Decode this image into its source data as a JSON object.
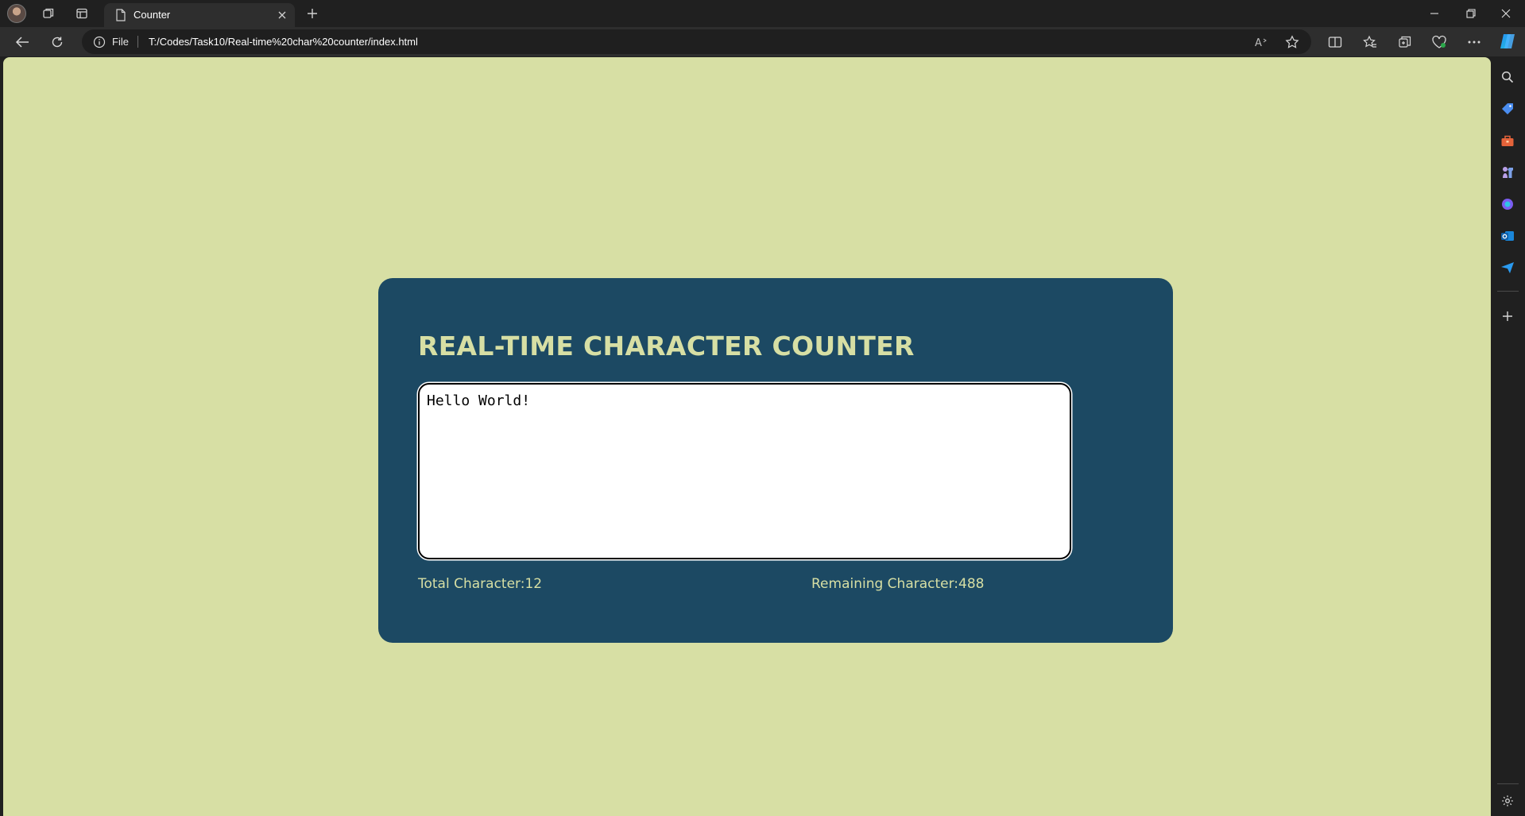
{
  "browser": {
    "tab_title": "Counter",
    "address_prefix": "File",
    "url": "T:/Codes/Task10/Real-time%20char%20counter/index.html"
  },
  "app": {
    "title": "REAL-TIME CHARACTER COUNTER",
    "textarea_value": "Hello World!",
    "total_label": "Total Character:",
    "total_count": "12",
    "remaining_label": "Remaining Character:",
    "remaining_count": "488"
  },
  "colors": {
    "page_background": "#d7dfa4",
    "card_background": "#1c4963",
    "accent_text": "#d7dfa4"
  },
  "icons": {
    "sidebar": [
      "search-icon",
      "tag-icon",
      "toolbox-icon",
      "chess-icon",
      "copilot-app-icon",
      "outlook-icon",
      "send-icon",
      "add-icon",
      "settings-icon"
    ]
  }
}
